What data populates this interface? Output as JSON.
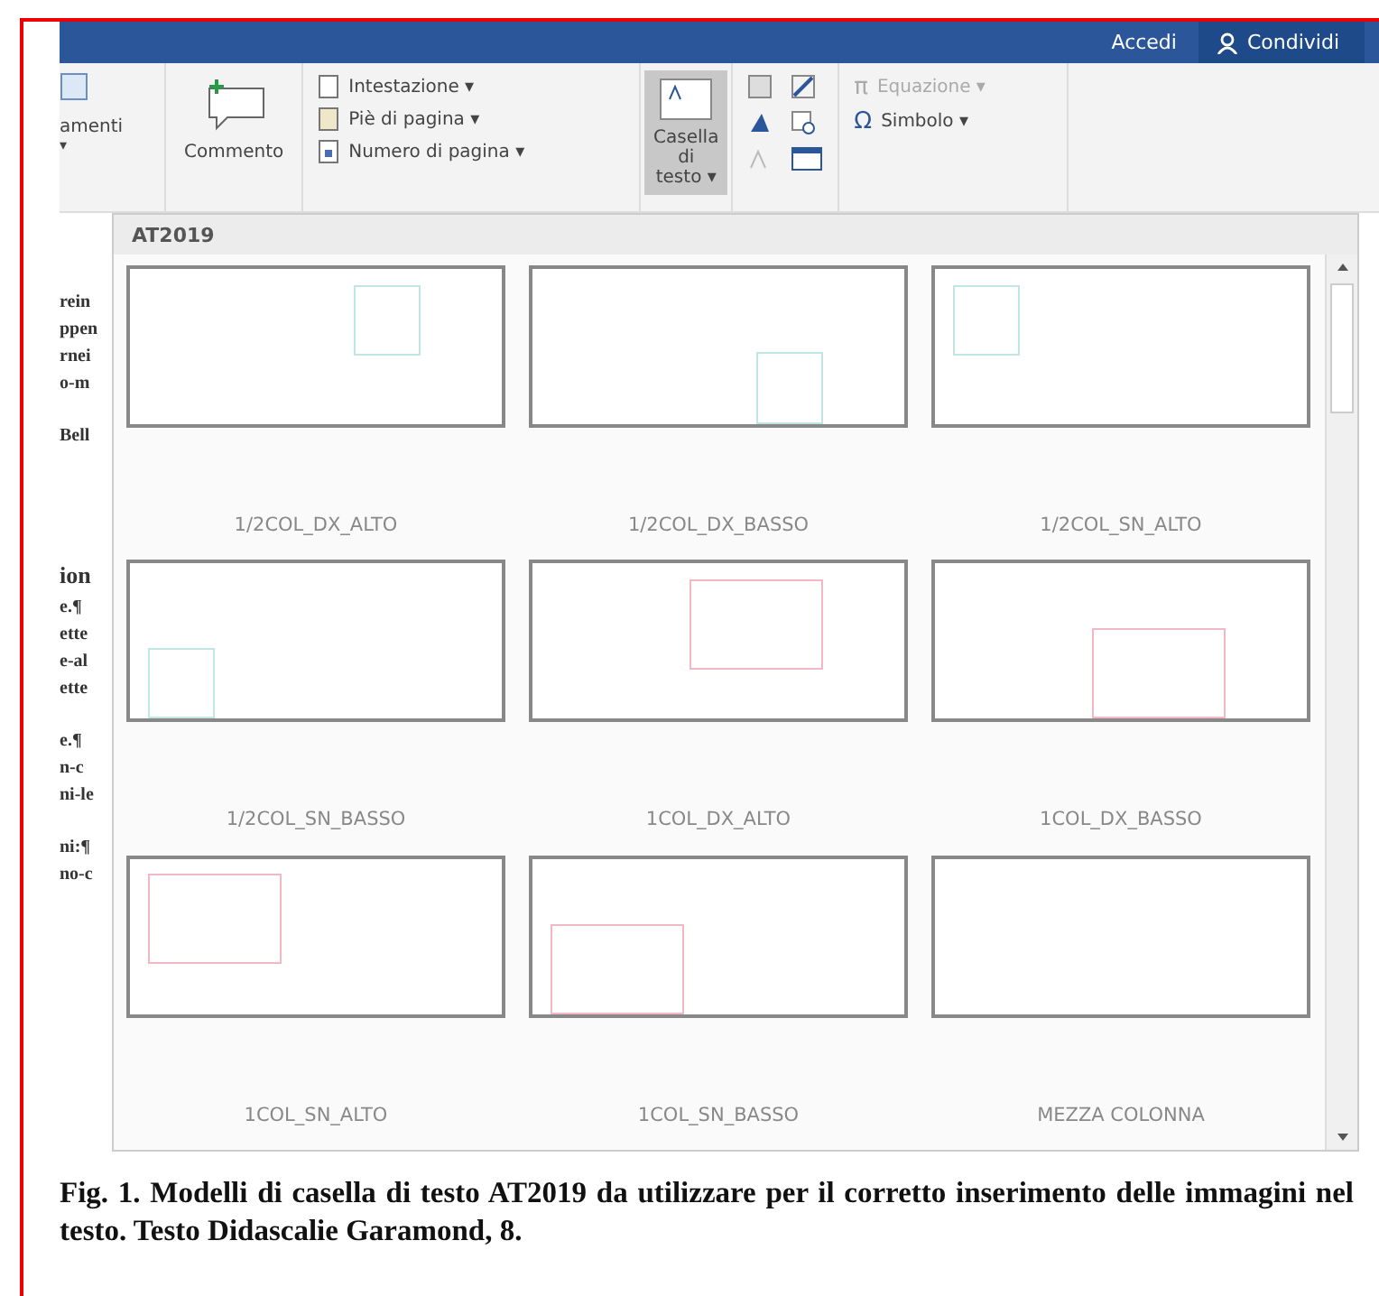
{
  "title_bar": {
    "sign_in": "Accedi",
    "share": "Condividi"
  },
  "ribbon": {
    "partial_label": "amenti",
    "partial_caret": "▾",
    "comment": "Commento",
    "header_footer": [
      {
        "label": "Intestazione ▾",
        "kind": "header"
      },
      {
        "label": "Piè di pagina ▾",
        "kind": "footer"
      },
      {
        "label": "Numero di pagina ▾",
        "kind": "number"
      }
    ],
    "text_box": {
      "label": "Casella di testo ▾",
      "selected": true
    },
    "symbols": [
      {
        "label": "Equazione ▾",
        "disabled": true,
        "icon": "π"
      },
      {
        "label": "Simbolo ▾",
        "disabled": false,
        "icon": "Ω"
      }
    ]
  },
  "document_fragments": [
    "rein",
    "ppen",
    "rnei",
    "o-m",
    "Bell",
    "ion",
    "e.¶",
    "ette",
    "e-al",
    "ette",
    "e.¶",
    "n-c",
    "ni-le",
    "ni:¶",
    "no-c"
  ],
  "gallery": {
    "heading": "AT2019",
    "items": [
      {
        "label": "1/2COL_DX_ALTO",
        "kind": "narrowrighttop",
        "color": "#bfe6e2"
      },
      {
        "label": "1/2COL_DX_BASSO",
        "kind": "narrowrightbottom",
        "color": "#bfe6e2"
      },
      {
        "label": "1/2COL_SN_ALTO",
        "kind": "narrowlefttop",
        "color": "#bfe6e2"
      },
      {
        "label": "1/2COL_SN_BASSO",
        "kind": "narrowleftbottom",
        "color": "#bfe6e2"
      },
      {
        "label": "1COL_DX_ALTO",
        "kind": "widerighttop",
        "color": "#f3b8c4"
      },
      {
        "label": "1COL_DX_BASSO",
        "kind": "widerightbottom",
        "color": "#f3b8c4"
      },
      {
        "label": "1COL_SN_ALTO",
        "kind": "widelefttop",
        "color": "#f3b8c4"
      },
      {
        "label": "1COL_SN_BASSO",
        "kind": "wideleftbottom",
        "color": "#f3b8c4"
      },
      {
        "label": "MEZZA COLONNA",
        "kind": "empty"
      }
    ]
  },
  "caption": "Fig. 1. Modelli di casella di testo AT2019 da utilizzare per il corretto inserimento delle immagini nel testo. Testo Didascalie Garamond, 8."
}
